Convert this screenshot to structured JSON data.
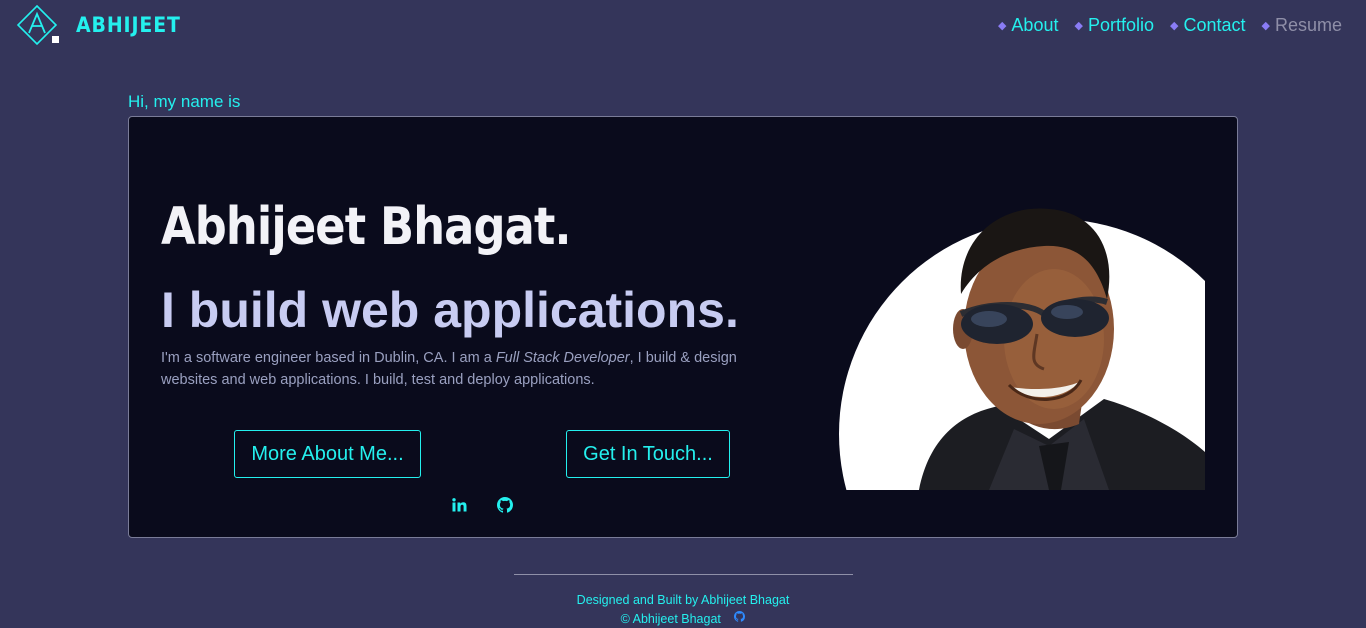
{
  "header": {
    "brand_name": "ABHIJEET",
    "logo_icon": "a-diamond-logo-icon",
    "nav": [
      {
        "label": "About"
      },
      {
        "label": "Portfolio"
      },
      {
        "label": "Contact"
      },
      {
        "label": "Resume"
      }
    ]
  },
  "hero": {
    "greeting": "Hi, my name is",
    "name": "Abhijeet Bhagat.",
    "tagline": "I build web applications.",
    "desc_part1": "I'm a software engineer based in Dublin, CA. I am a ",
    "desc_emphasis": "Full Stack Developer",
    "desc_part2": ", I build & design websites and web applications. I build, test and deploy applications.",
    "buttons": {
      "about": "More About Me...",
      "touch": "Get In Touch..."
    },
    "social": [
      "linkedin-icon",
      "github-icon"
    ]
  },
  "footer": {
    "line1": "Designed and Built by Abhijeet Bhagat",
    "line2": "© Abhijeet Bhagat"
  },
  "colors": {
    "background": "#34355a",
    "accent": "#24f0ee",
    "card": "#0a0b1c",
    "nav_diamond": "#8a7cf5"
  }
}
